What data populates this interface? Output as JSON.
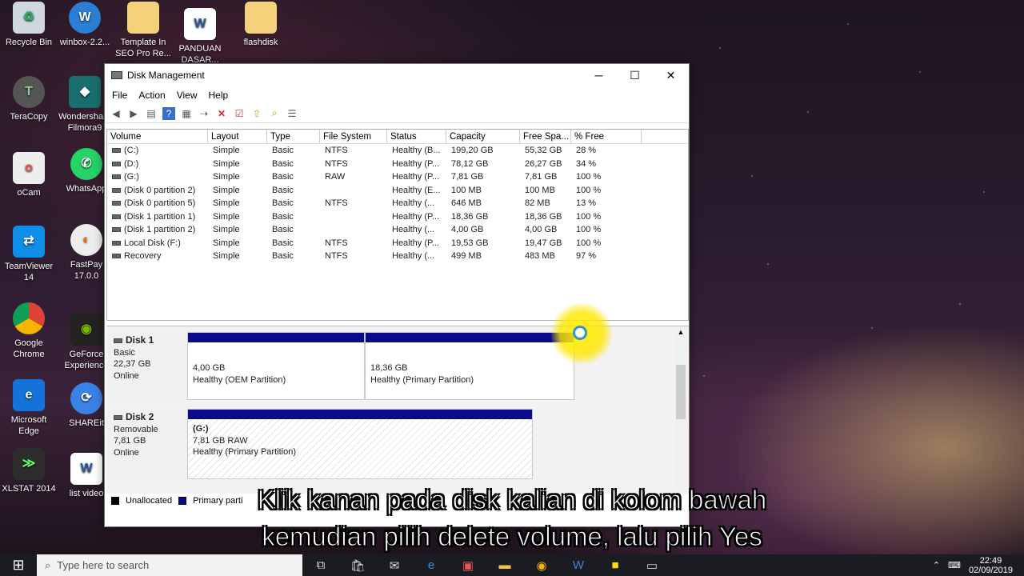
{
  "desktop": {
    "icons": [
      {
        "label": "Recycle Bin",
        "icon": "recycle-bin-icon"
      },
      {
        "label": "winbox-2.2...",
        "icon": "winbox-icon"
      },
      {
        "label": "Template In SEO Pro Re...",
        "icon": "folder-icon"
      },
      {
        "label": "PANDUAN DASAR...",
        "icon": "word-doc-icon"
      },
      {
        "label": "flashdisk",
        "icon": "folder-icon"
      },
      {
        "label": "TeraCopy",
        "icon": "teracopy-icon"
      },
      {
        "label": "Wondershare Filmora9",
        "icon": "filmora-icon"
      },
      {
        "label": "oCam",
        "icon": "ocam-icon"
      },
      {
        "label": "WhatsApp",
        "icon": "whatsapp-icon"
      },
      {
        "label": "TeamViewer 14",
        "icon": "teamviewer-icon"
      },
      {
        "label": "FastPay 17.0.0",
        "icon": "fastpay-icon"
      },
      {
        "label": "Google Chrome",
        "icon": "chrome-icon"
      },
      {
        "label": "GeForce Experience",
        "icon": "geforce-icon"
      },
      {
        "label": "Microsoft Edge",
        "icon": "edge-icon"
      },
      {
        "label": "SHAREit",
        "icon": "shareit-icon"
      },
      {
        "label": "XLSTAT 2014",
        "icon": "xlstat-icon"
      },
      {
        "label": "list video",
        "icon": "word-doc-icon"
      }
    ]
  },
  "window": {
    "title": "Disk Management",
    "menu": [
      "File",
      "Action",
      "View",
      "Help"
    ],
    "columns": [
      "Volume",
      "Layout",
      "Type",
      "File System",
      "Status",
      "Capacity",
      "Free Spa...",
      "% Free"
    ],
    "rows": [
      [
        "(C:)",
        "Simple",
        "Basic",
        "NTFS",
        "Healthy (B...",
        "199,20 GB",
        "55,32 GB",
        "28 %"
      ],
      [
        "(D:)",
        "Simple",
        "Basic",
        "NTFS",
        "Healthy (P...",
        "78,12 GB",
        "26,27 GB",
        "34 %"
      ],
      [
        "(G:)",
        "Simple",
        "Basic",
        "RAW",
        "Healthy (P...",
        "7,81 GB",
        "7,81 GB",
        "100 %"
      ],
      [
        "(Disk 0 partition 2)",
        "Simple",
        "Basic",
        "",
        "Healthy (E...",
        "100 MB",
        "100 MB",
        "100 %"
      ],
      [
        "(Disk 0 partition 5)",
        "Simple",
        "Basic",
        "NTFS",
        "Healthy (...",
        "646 MB",
        "82 MB",
        "13 %"
      ],
      [
        "(Disk 1 partition 1)",
        "Simple",
        "Basic",
        "",
        "Healthy (P...",
        "18,36 GB",
        "18,36 GB",
        "100 %"
      ],
      [
        "(Disk 1 partition 2)",
        "Simple",
        "Basic",
        "",
        "Healthy (...",
        "4,00 GB",
        "4,00 GB",
        "100 %"
      ],
      [
        "Local Disk (F:)",
        "Simple",
        "Basic",
        "NTFS",
        "Healthy (P...",
        "19,53 GB",
        "19,47 GB",
        "100 %"
      ],
      [
        "Recovery",
        "Simple",
        "Basic",
        "NTFS",
        "Healthy (...",
        "499 MB",
        "483 MB",
        "97 %"
      ]
    ],
    "disks": [
      {
        "name": "Disk 1",
        "kind": "Basic",
        "size": "22,37 GB",
        "state": "Online",
        "parts": [
          {
            "size": "4,00 GB",
            "status": "Healthy (OEM Partition)"
          },
          {
            "size": "18,36 GB",
            "status": "Healthy (Primary Partition)"
          }
        ]
      },
      {
        "name": "Disk 2",
        "kind": "Removable",
        "size": "7,81 GB",
        "state": "Online",
        "parts": [
          {
            "label": "(G:)",
            "size": "7,81 GB RAW",
            "status": "Healthy (Primary Partition)"
          }
        ]
      }
    ],
    "legend": [
      "Unallocated",
      "Primary parti"
    ],
    "legend_colors": [
      "#000000",
      "#0a0a8a"
    ]
  },
  "subtitles": [
    "Klik kanan pada disk kalian di kolom bawah",
    "kemudian pilih delete volume, lalu pilih Yes"
  ],
  "taskbar": {
    "search_placeholder": "Type here to search",
    "time": "22:49",
    "date": "02/09/2019"
  }
}
